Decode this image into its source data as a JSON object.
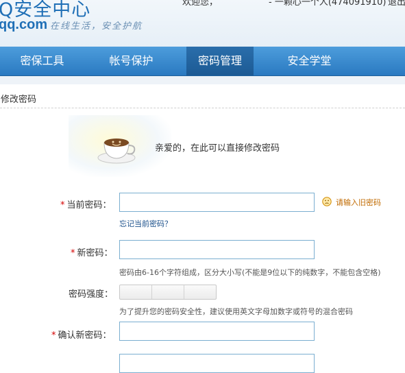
{
  "header": {
    "logo_title": "Q安全中心",
    "logo_domain": "qq.com",
    "logo_slogan": "在线生活，安全护航",
    "welcome": "欢迎您，",
    "username": "- 一颗心一个人(474091910)",
    "logout": "退出"
  },
  "nav": {
    "items": [
      {
        "label": "密保工具",
        "active": false
      },
      {
        "label": "帐号保护",
        "active": false
      },
      {
        "label": "密码管理",
        "active": true
      },
      {
        "label": "安全学堂",
        "active": false
      }
    ]
  },
  "page": {
    "section_title": "修改密码",
    "greeting": "亲爱的，在此可以直接修改密码"
  },
  "form": {
    "current_password_label": "当前密码：",
    "current_password_warning": "请输入旧密码",
    "forgot_link": "忘记当前密码？",
    "new_password_label": "新密码：",
    "new_password_hint": "密码由6-16个字符组成，区分大小写(不能是9位以下的纯数字，不能包含空格)",
    "strength_label": "密码强度：",
    "strength_hint": "为了提升您的密码安全性，建议使用英文字母加数字或符号的混合密码",
    "confirm_password_label": "确认新密码："
  },
  "colors": {
    "nav_bg": "#2a79c0",
    "brand_blue": "#1f6fb6",
    "required_star": "#d40000",
    "warning_text": "#c06a00",
    "link": "#1a4f8a"
  },
  "icons": {
    "coffee": "coffee-cup-icon",
    "warning": "sad-face-warning-icon"
  }
}
